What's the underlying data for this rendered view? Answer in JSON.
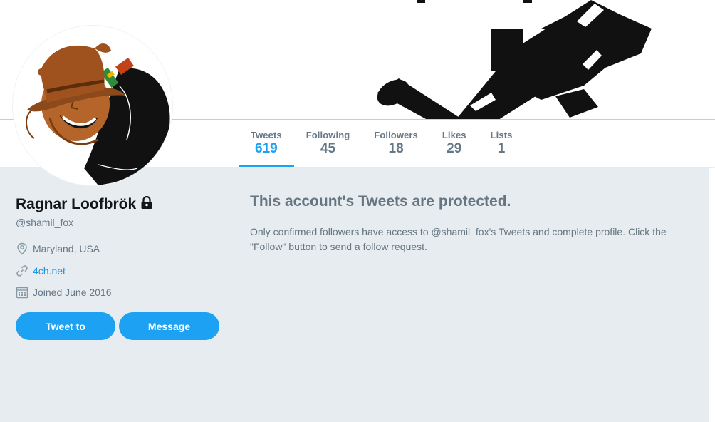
{
  "profile": {
    "name": "Ragnar Loofbrök",
    "handle": "@shamil_fox",
    "location": "Maryland, USA",
    "website": "4ch.net",
    "joined": "Joined June 2016"
  },
  "stats": [
    {
      "label": "Tweets",
      "value": "619",
      "active": true
    },
    {
      "label": "Following",
      "value": "45",
      "active": false
    },
    {
      "label": "Followers",
      "value": "18",
      "active": false
    },
    {
      "label": "Likes",
      "value": "29",
      "active": false
    },
    {
      "label": "Lists",
      "value": "1",
      "active": false
    }
  ],
  "actions": {
    "tweet_to_label": "Tweet to",
    "message_label": "Message"
  },
  "protected": {
    "title": "This account's Tweets are protected.",
    "body": "Only confirmed followers have access to @shamil_fox's Tweets and complete profile. Click the \"Follow\" button to send a follow request."
  },
  "colors": {
    "accent": "#1da1f2",
    "link": "#1b95e0",
    "page_background": "#e6ecf0",
    "muted_text": "#657786",
    "name_text": "#14171a"
  },
  "icons": {
    "location": "location-pin-icon",
    "website": "link-icon",
    "joined": "calendar-icon",
    "protected": "lock-icon"
  }
}
